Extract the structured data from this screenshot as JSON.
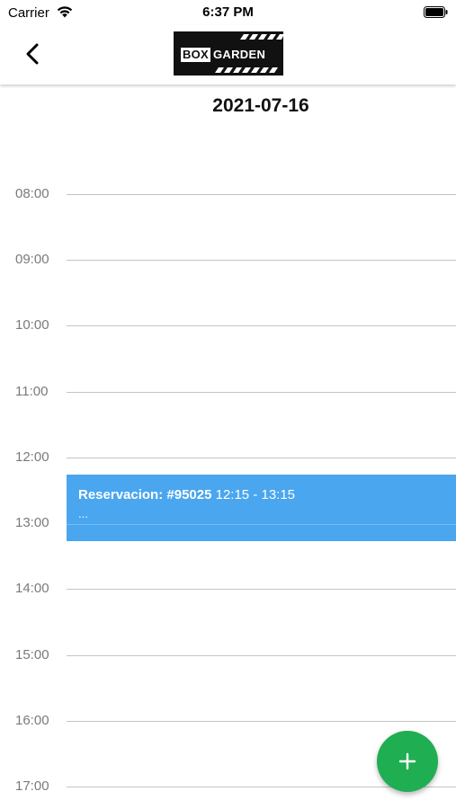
{
  "status_bar": {
    "carrier": "Carrier",
    "time": "6:37 PM",
    "wifi_icon": "wifi-icon",
    "battery_icon": "battery-icon"
  },
  "nav": {
    "back_icon": "chevron-left-icon",
    "logo": {
      "part1": "BOX",
      "part2": "GARDEN"
    }
  },
  "date": "2021-07-16",
  "timeline": {
    "hours": [
      "08:00",
      "09:00",
      "10:00",
      "11:00",
      "12:00",
      "13:00",
      "14:00",
      "15:00",
      "16:00",
      "17:00"
    ]
  },
  "event": {
    "title": "Reservacion: #95025",
    "time_range": "12:15 - 13:15",
    "description": "...",
    "color": "#4aa6ee"
  },
  "fab": {
    "icon": "plus-icon",
    "color": "#1fae52"
  }
}
